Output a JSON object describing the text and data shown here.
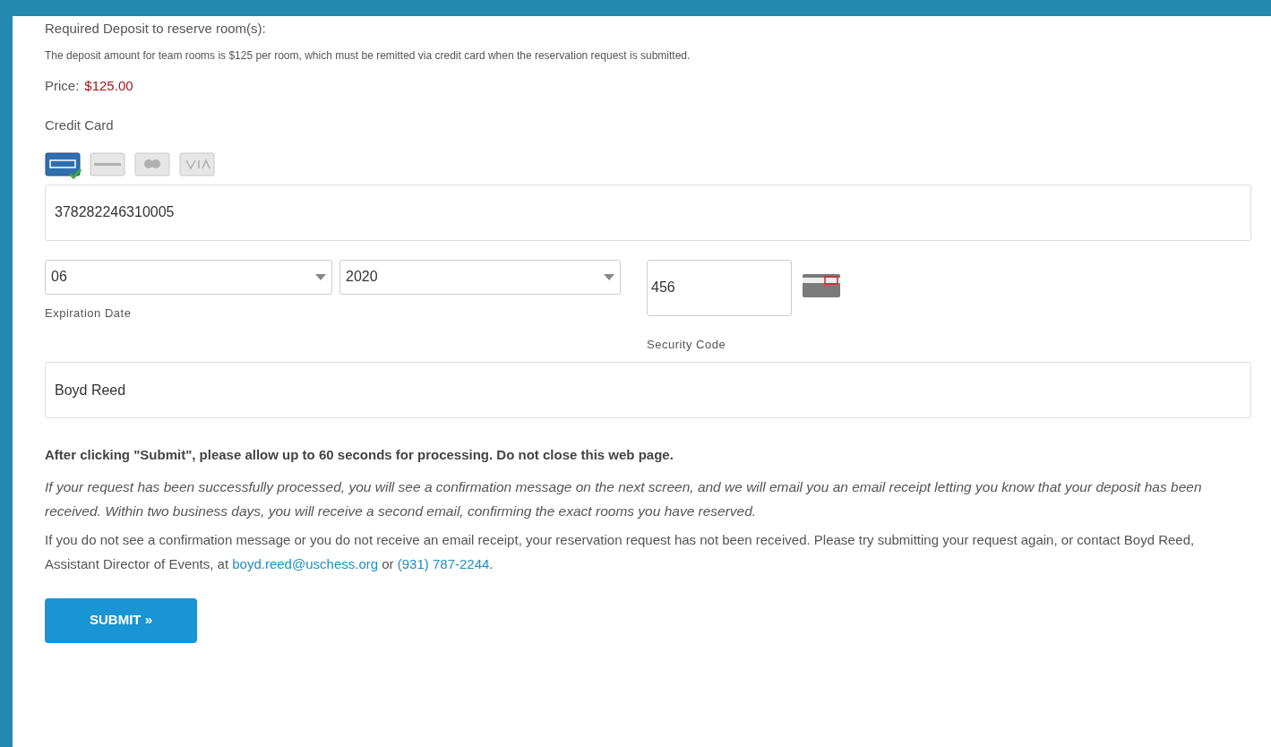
{
  "deposit_heading": "Required Deposit to reserve room(s):",
  "deposit_note": "The deposit amount for team rooms is $125 per room, which must be remitted via credit card when the reservation request is submitted.",
  "price": {
    "label": "Price:",
    "value": "$125.00"
  },
  "credit_card": {
    "label": "Credit Card",
    "card_types": [
      {
        "kind": "amex",
        "selected": true
      },
      {
        "kind": "discover",
        "selected": false
      },
      {
        "kind": "mastercard",
        "selected": false
      },
      {
        "kind": "visa",
        "selected": false
      }
    ],
    "number": "378282246310005",
    "exp_month": "06",
    "exp_year": "2020",
    "exp_label": "Expiration Date",
    "security_code": "456",
    "security_label": "Security Code",
    "cardholder": "Boyd Reed"
  },
  "processing_notice": "After clicking \"Submit\", please allow up to 60 seconds for processing. Do not close this web page.",
  "confirmation_info": "If your request has been successfully processed, you will see a confirmation message on the next screen, and we will email you an email receipt letting you know that your deposit has been received. Within two business days, you will receive a second email, confirming the exact rooms you have reserved.",
  "contact": {
    "text": "If you do not see a confirmation message or you do not receive an email receipt, your reservation request has not been received. Please try submitting your request again, or contact Boyd Reed, Assistant Director of Events, at ",
    "email": "boyd.reed@uschess.org",
    "between": " or ",
    "phone": "(931) 787-2244",
    "after": "."
  },
  "submit_button": "SUBMIT »"
}
